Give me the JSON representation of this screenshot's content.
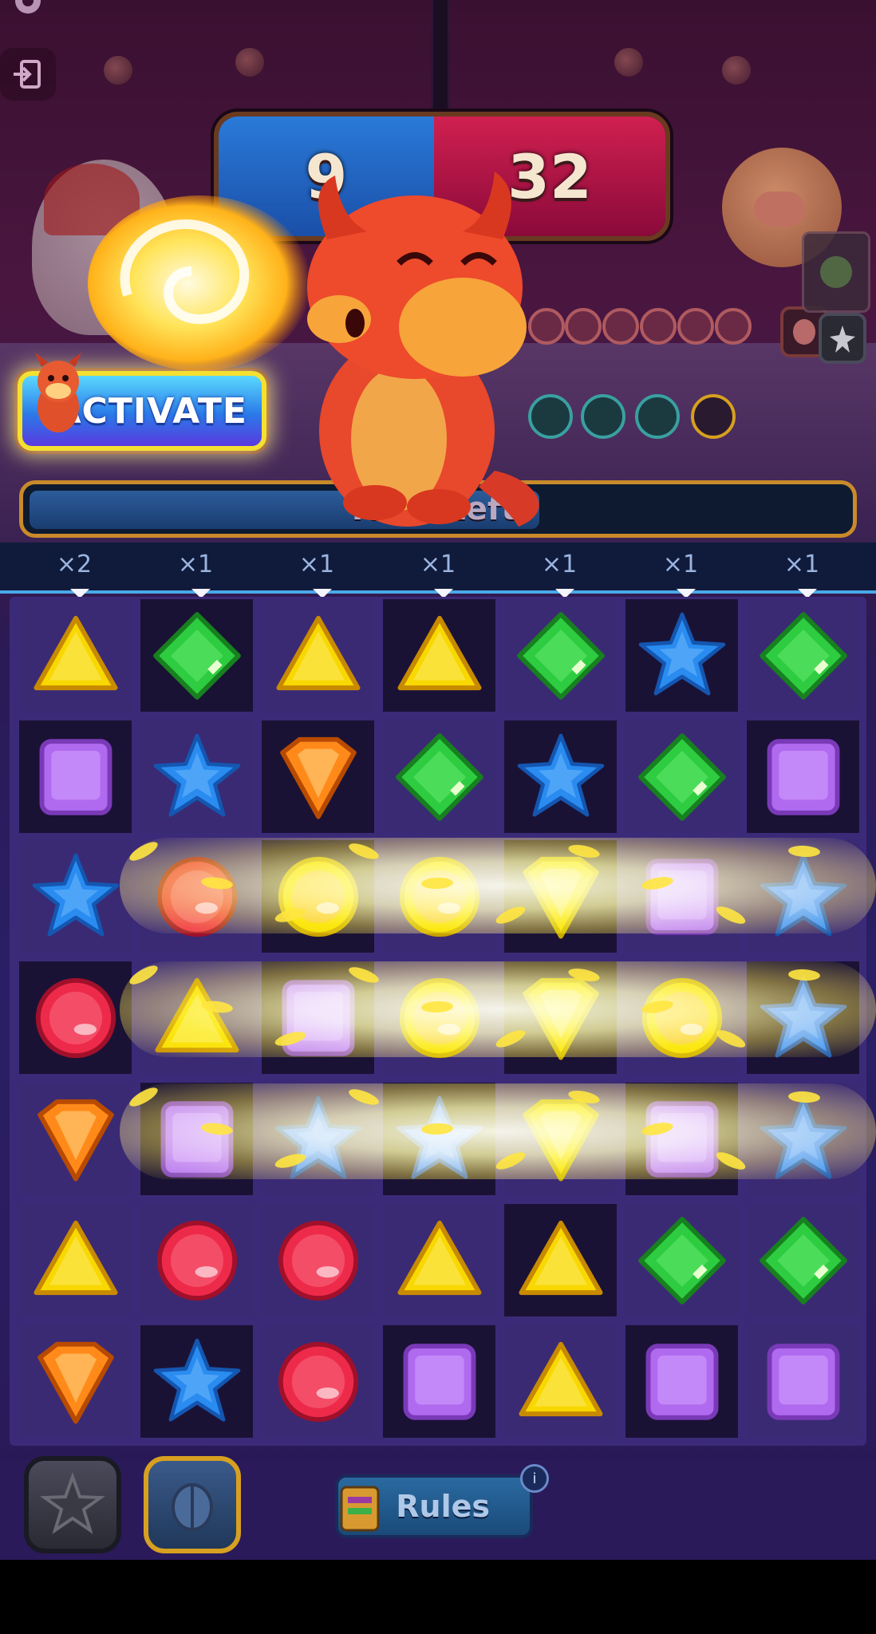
{
  "scoreboard": {
    "player_score": "9",
    "opponent_score": "32"
  },
  "activate_button": {
    "label": "ACTIVATE"
  },
  "timer": {
    "label": "Time Left:",
    "fraction_remaining": 0.62
  },
  "multipliers": [
    "×2",
    "×1",
    "×1",
    "×1",
    "×1",
    "×1",
    "×1"
  ],
  "board": {
    "rows": [
      [
        "triangle-yellow",
        "diamond-green",
        "triangle-yellow",
        "triangle-yellow",
        "diamond-green",
        "star-blue",
        "diamond-green"
      ],
      [
        "square-purple",
        "star-blue",
        "shield-orange",
        "diamond-green",
        "star-blue",
        "diamond-green",
        "square-purple"
      ],
      [
        "star-blue",
        "circle-red",
        "circle-yellow",
        "circle-yellow",
        "shield-yellow",
        "square-purple",
        "star-blue"
      ],
      [
        "circle-red",
        "triangle-yellow",
        "square-purple",
        "circle-yellow",
        "shield-yellow",
        "circle-yellow",
        "star-blue"
      ],
      [
        "shield-orange",
        "square-purple",
        "star-blue",
        "star-blue",
        "shield-yellow",
        "square-purple",
        "star-blue"
      ],
      [
        "triangle-yellow",
        "circle-red",
        "circle-red",
        "triangle-yellow",
        "triangle-yellow",
        "diamond-green",
        "diamond-green"
      ],
      [
        "shield-orange",
        "star-blue",
        "circle-red",
        "square-purple",
        "triangle-yellow",
        "square-purple",
        "square-purple"
      ]
    ],
    "lightning_rows": [
      2,
      3,
      4
    ]
  },
  "bottom_bar": {
    "rules_label": "Rules",
    "info_label": "i"
  },
  "colors": {
    "yellow": "#f8d800",
    "green": "#2ecc40",
    "blue": "#2a8cf0",
    "orange": "#ff8a1a",
    "purple": "#b06af0",
    "red": "#ee2a4a"
  },
  "icons": [
    "gear-icon",
    "exit-icon",
    "star-burst-icon",
    "scarab-icon",
    "card-stack-icon"
  ]
}
